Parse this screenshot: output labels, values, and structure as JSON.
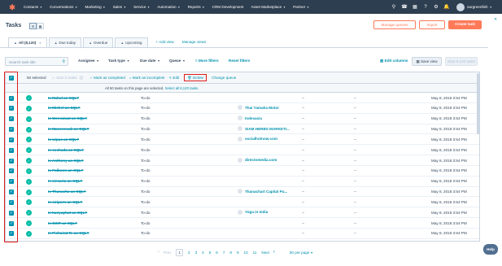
{
  "nav": {
    "logo": "hubspot-logo",
    "items": [
      "Contacts",
      "Conversations",
      "Marketing",
      "Sales",
      "Service",
      "Automation",
      "Reports",
      "CRM Development",
      "Asset Marketplace",
      "Partner"
    ],
    "has_caret": [
      true,
      true,
      true,
      true,
      true,
      true,
      true,
      false,
      true,
      true
    ],
    "account_name": "ourgreenfish"
  },
  "header": {
    "title": "Tasks",
    "manage_queues": "Manage queues",
    "import": "Import",
    "create_task": "Create task"
  },
  "tabs": {
    "items": [
      "All (8,120)",
      "Due today",
      "Overdue",
      "Upcoming"
    ],
    "add_view": "+ Add view",
    "manage_views": "Manage views"
  },
  "filters": {
    "search_placeholder": "Search task title",
    "assignee": "Assignee",
    "task_type": "Task type",
    "due_date": "Due date",
    "queue": "Queue",
    "more_filters": "More filters",
    "reset_filters": "Reset filters",
    "edit_columns": "Edit columns",
    "save_view": "Save view",
    "start_tasks": "Start 8,120 tasks"
  },
  "bulk": {
    "selected": "50 selected",
    "start_tasks": "Start 5 tasks",
    "mark_completed": "Mark as completed",
    "mark_incomplete": "Mark as incomplete",
    "edit": "Edit",
    "delete": "Delete",
    "change_queue": "Change queue",
    "info_text": "All 50 tasks on this page are selected.",
    "select_all": "Select all 8,120 tasks."
  },
  "rows": [
    {
      "title": "Is Rahul an SQL?",
      "status": "To-do",
      "company": "",
      "d1": "--",
      "d2": "--",
      "date": "May 8, 2018 3:54 PM"
    },
    {
      "title": "Is Michel an SQL?",
      "status": "To-do",
      "company": "Thai Yamaha Motor",
      "d1": "--",
      "d2": "--",
      "date": "May 8, 2018 3:54 PM"
    },
    {
      "title": "Is Weeraiwat an SQL?",
      "status": "To-do",
      "company": "Indexasia",
      "d1": "--",
      "d2": "--",
      "date": "May 8, 2018 3:54 PM"
    },
    {
      "title": "Is Manoonsak an SQL?",
      "status": "To-do",
      "company": "SIAM HERBS MARKETI...",
      "d1": "--",
      "d2": "--",
      "date": "May 8, 2018 3:54 PM"
    },
    {
      "title": "Is wipas an SQL?",
      "status": "To-do",
      "company": "socialhotnow.com",
      "d1": "--",
      "d2": "--",
      "date": "May 8, 2018 3:54 PM"
    },
    {
      "title": "Is sochada an SQL?",
      "status": "To-do",
      "company": "",
      "d1": "--",
      "d2": "--",
      "date": "May 8, 2018 3:54 PM"
    },
    {
      "title": "Is Anthony an SQL?",
      "status": "To-do",
      "company": "directomedia.com",
      "d1": "--",
      "d2": "--",
      "date": "May 8, 2018 3:54 PM"
    },
    {
      "title": "Is Palboon an SQL?",
      "status": "To-do",
      "company": "",
      "d1": "--",
      "d2": "--",
      "date": "May 8, 2018 3:54 PM"
    },
    {
      "title": "Is siesaria an SQL?",
      "status": "To-do",
      "company": "",
      "d1": "--",
      "d2": "--",
      "date": "May 8, 2018 3:54 PM"
    },
    {
      "title": "Is Thanacha an SQL?",
      "status": "To-do",
      "company": "Thanachart Capital Pu...",
      "d1": "--",
      "d2": "--",
      "date": "May 8, 2018 3:54 PM"
    },
    {
      "title": "Is siriporn an SQL?",
      "status": "To-do",
      "company": "",
      "d1": "--",
      "d2": "--",
      "date": "May 8, 2018 3:54 PM"
    },
    {
      "title": "Is kunyaphat an SQL?",
      "status": "To-do",
      "company": "Yoga in India",
      "d1": "--",
      "d2": "--",
      "date": "May 8, 2018 3:54 PM"
    },
    {
      "title": "Is GSIT an SQL?",
      "status": "To-do",
      "company": "",
      "d1": "--",
      "d2": "--",
      "date": "May 8, 2018 3:54 PM"
    },
    {
      "title": "Is Pichairat R. an SQL?",
      "status": "To-do",
      "company": "",
      "d1": "--",
      "d2": "--",
      "date": "May 8, 2018 3:54 PM"
    }
  ],
  "pagination": {
    "prev": "Prev",
    "pages": [
      "1",
      "2",
      "3",
      "4",
      "5",
      "6",
      "7",
      "8",
      "9",
      "10",
      "11"
    ],
    "current": "1",
    "next": "Next",
    "per_page": "50 per page"
  },
  "help": "Help",
  "colors": {
    "nav_bg": "#2d3e50",
    "accent": "#ff7a59",
    "link": "#0091ae",
    "done_green": "#00bda5",
    "highlight_red": "#e01b1b"
  }
}
